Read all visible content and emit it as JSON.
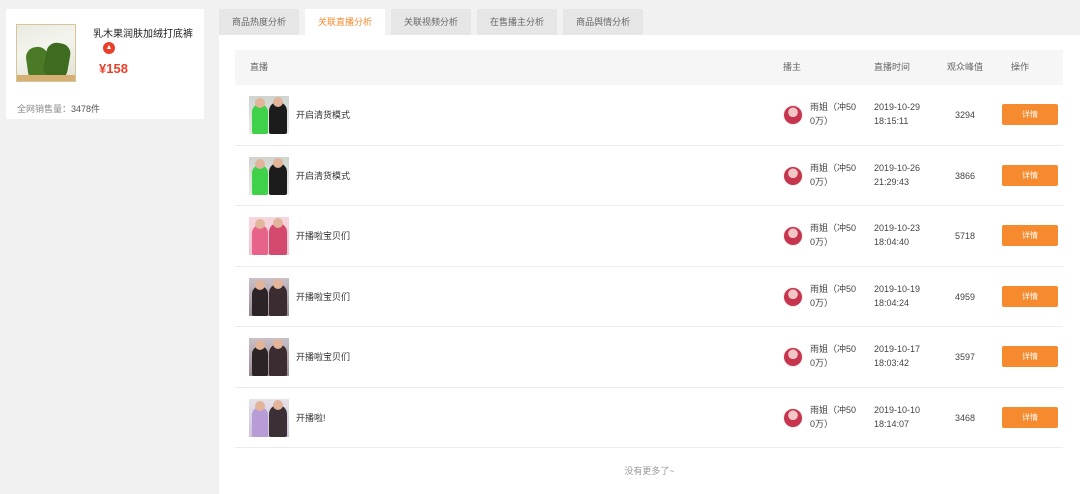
{
  "product": {
    "name": "乳木果润肤加绒打底裤",
    "hot_badge": "▲",
    "price": "¥158",
    "sales_label": "全网销售量：",
    "sales_value": "3478件"
  },
  "tabs": [
    {
      "label": "商品热度分析",
      "active": false
    },
    {
      "label": "关联直播分析",
      "active": true
    },
    {
      "label": "关联视频分析",
      "active": false
    },
    {
      "label": "在售播主分析",
      "active": false
    },
    {
      "label": "商品舆情分析",
      "active": false
    }
  ],
  "table": {
    "headers": {
      "live": "直播",
      "host": "播主",
      "time": "直播时间",
      "peak": "观众峰值",
      "action": "操作"
    },
    "rows": [
      {
        "title": "开启清货模式",
        "host": "雨姐（冲500万）",
        "date": "2019-10-29",
        "clock": "18:15:11",
        "peak": "3294",
        "action": "详情",
        "cover": "green"
      },
      {
        "title": "开启清货模式",
        "host": "雨姐（冲500万）",
        "date": "2019-10-26",
        "clock": "21:29:43",
        "peak": "3866",
        "action": "详情",
        "cover": "green"
      },
      {
        "title": "开播啦宝贝们",
        "host": "雨姐（冲500万）",
        "date": "2019-10-23",
        "clock": "18:04:40",
        "peak": "5718",
        "action": "详情",
        "cover": "pink"
      },
      {
        "title": "开播啦宝贝们",
        "host": "雨姐（冲500万）",
        "date": "2019-10-19",
        "clock": "18:04:24",
        "peak": "4959",
        "action": "详情",
        "cover": "purple"
      },
      {
        "title": "开播啦宝贝们",
        "host": "雨姐（冲500万）",
        "date": "2019-10-17",
        "clock": "18:03:42",
        "peak": "3597",
        "action": "详情",
        "cover": "purple"
      },
      {
        "title": "开播啦!",
        "host": "雨姐（冲500万）",
        "date": "2019-10-10",
        "clock": "18:14:07",
        "peak": "3468",
        "action": "详情",
        "cover": "lilac"
      }
    ]
  },
  "footer": {
    "no_more": "没有更多了~"
  },
  "colors": {
    "accent": "#f58b2e",
    "price": "#e8402a"
  }
}
